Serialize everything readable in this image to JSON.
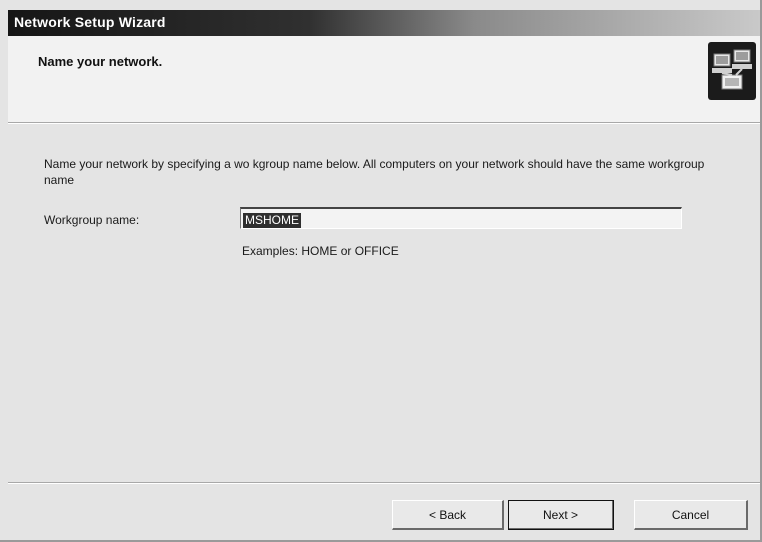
{
  "window": {
    "title": "Network Setup Wizard"
  },
  "header": {
    "title": "Name your network.",
    "icon": "network-computers-icon"
  },
  "main": {
    "description": "Name your network by specifying a wo kgroup name below. All computers on your network should have the same workgroup name",
    "workgroup_label": "Workgroup name:",
    "workgroup_value": "MSHOME",
    "example": "Examples: HOME or OFFICE"
  },
  "buttons": {
    "back": "< Back",
    "next": "Next >",
    "cancel": "Cancel"
  },
  "colors": {
    "titlebar_dark": "#161616",
    "selection": "#2f2f2f"
  }
}
